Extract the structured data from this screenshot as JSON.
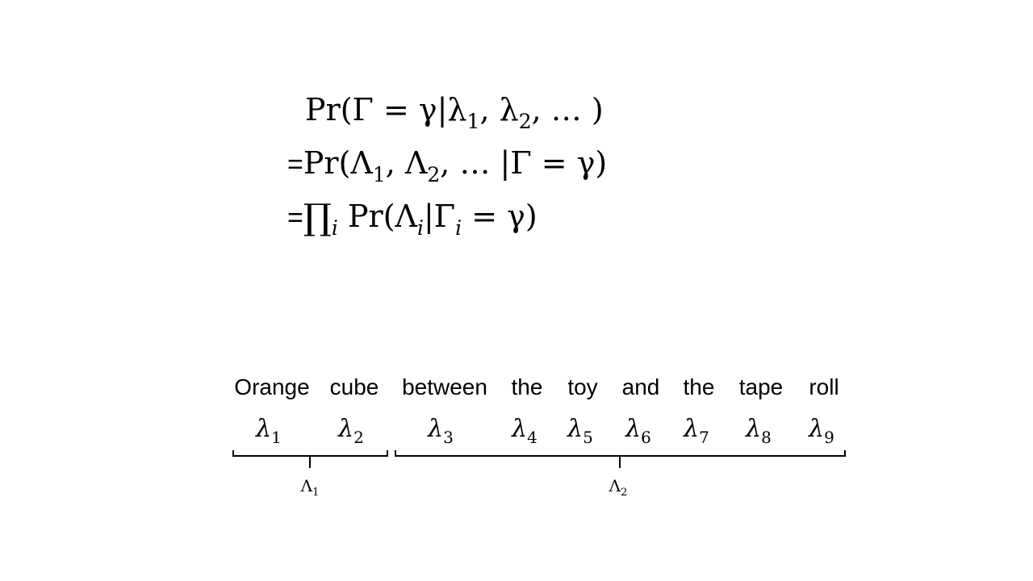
{
  "equations": {
    "line1": {
      "prefix": "",
      "lhs": "Pr(Γ = γ|λ",
      "s1": "1",
      "mid": ", λ",
      "s2": "2",
      "tail": ", … )"
    },
    "line2": {
      "prefix": "=",
      "a": "Pr(Λ",
      "s1": "1",
      "b": ", Λ",
      "s2": "2",
      "c": ", … |Γ = γ)"
    },
    "line3": {
      "prefix": "=",
      "prod": "∏",
      "sub_i": "i",
      "a": " Pr(Λ",
      "sub_i2": "i",
      "b": "|Γ",
      "sub_i3": "i",
      "c": " = γ)"
    }
  },
  "sentence": {
    "words": [
      "Orange",
      "cube",
      "between",
      "the",
      "toy",
      "and",
      "the",
      "tape",
      "roll"
    ],
    "lambda_symbol": "λ",
    "lambda_subscripts": [
      "1",
      "2",
      "3",
      "4",
      "5",
      "6",
      "7",
      "8",
      "9"
    ]
  },
  "groups": [
    {
      "symbol": "Λ",
      "subscript": "1"
    },
    {
      "symbol": "Λ",
      "subscript": "2"
    }
  ]
}
